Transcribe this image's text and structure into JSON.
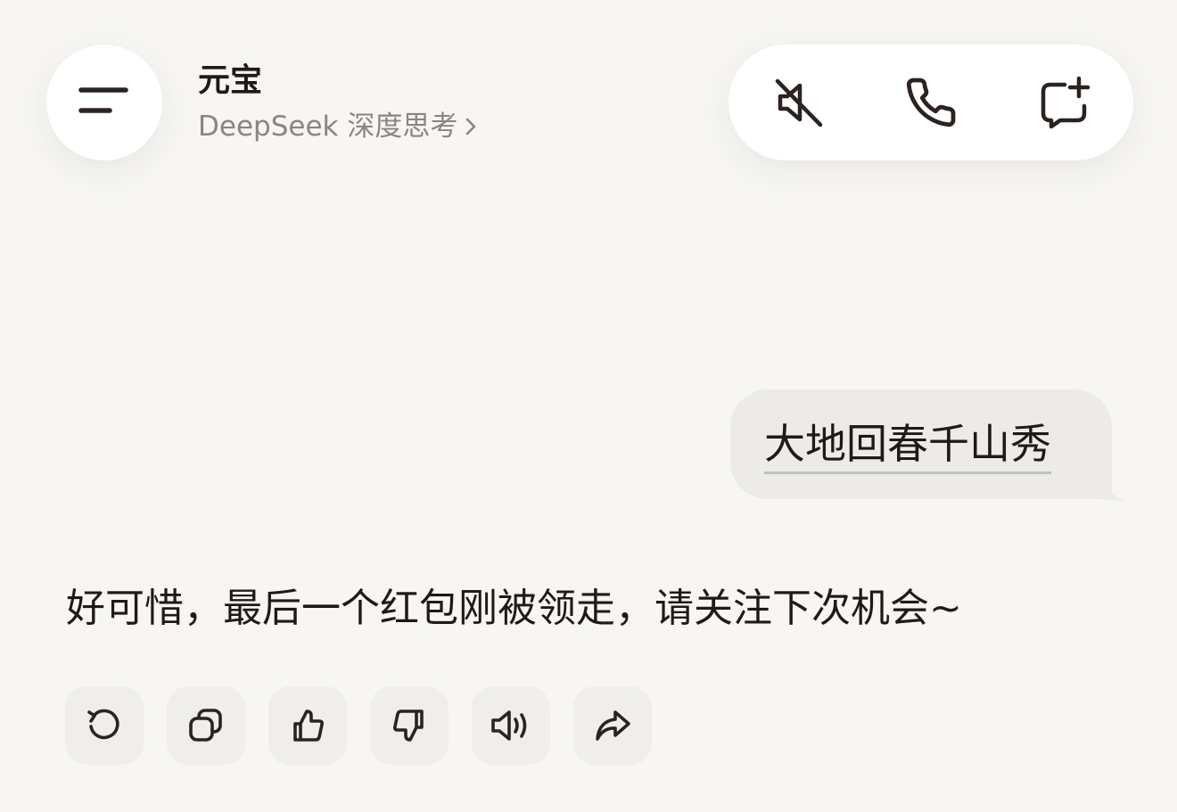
{
  "header": {
    "title": "元宝",
    "model_label": "DeepSeek 深度思考",
    "menu_icon": "menu-icon",
    "model_chevron_icon": "chevron-right-icon"
  },
  "top_actions": [
    {
      "id": "mute",
      "icon": "speaker-muted-icon"
    },
    {
      "id": "call",
      "icon": "phone-icon"
    },
    {
      "id": "new-chat",
      "icon": "new-chat-icon"
    }
  ],
  "messages": {
    "user": "大地回春千山秀",
    "assistant": "好可惜，最后一个红包刚被领走，请关注下次机会~"
  },
  "message_actions": [
    {
      "id": "regenerate",
      "icon": "refresh-icon"
    },
    {
      "id": "copy",
      "icon": "copy-icon"
    },
    {
      "id": "like",
      "icon": "thumbs-up-icon"
    },
    {
      "id": "dislike",
      "icon": "thumbs-down-icon"
    },
    {
      "id": "read-aloud",
      "icon": "speaker-icon"
    },
    {
      "id": "share",
      "icon": "share-icon"
    }
  ],
  "colors": {
    "background": "#f7f6f3",
    "surface": "#ffffff",
    "user_bubble": "#ecebe7",
    "action_button": "#efeeea",
    "icon": "#2a2320",
    "text": "#1f1a17",
    "muted_text": "#8a8580"
  }
}
